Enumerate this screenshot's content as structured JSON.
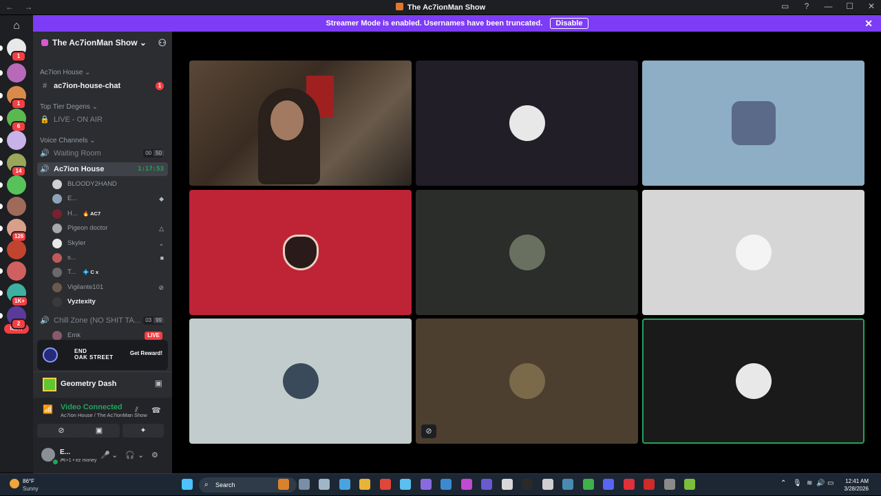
{
  "window": {
    "title": "The Ac7ionMan Show",
    "nav_back": "←",
    "nav_forward": "→",
    "controls": [
      "▭",
      "?",
      "—",
      "☐",
      "✕"
    ]
  },
  "banner": {
    "text": "Streamer Mode is enabled. Usernames have been truncated.",
    "disable_label": "Disable",
    "close": "✕"
  },
  "rail": {
    "discord_glyph": "⌂",
    "servers": [
      {
        "color": "#e8e8e8",
        "badge": "1"
      },
      {
        "color": "#b86ab8",
        "badge": ""
      },
      {
        "color": "#d98a4a",
        "badge": "1"
      },
      {
        "color": "#5bb84f",
        "badge": "6"
      },
      {
        "color": "#c7b3e8",
        "badge": ""
      },
      {
        "color": "#9aa65a",
        "badge": "14"
      },
      {
        "color": "#58c25a",
        "badge": ""
      },
      {
        "color": "#a06a5a",
        "badge": ""
      },
      {
        "color": "#d8a08a",
        "badge": "126"
      },
      {
        "color": "#c0442e",
        "badge": ""
      },
      {
        "color": "#d06060",
        "badge": ""
      },
      {
        "color": "#3fb0a0",
        "badge": "1K+"
      },
      {
        "color": "#5a3a9a",
        "badge": "2"
      }
    ],
    "new_label": "NEW"
  },
  "sidebar": {
    "server_name": "The Ac7ionMan Show",
    "chevron": "⌄",
    "add_user_glyph": "⚇",
    "categories": [
      {
        "label": "Ac7ion House ⌄"
      },
      {
        "label": "Top Tier Degens ⌄"
      },
      {
        "label": "Voice Channels ⌄"
      }
    ],
    "channels": {
      "chat": {
        "icon": "#",
        "name": "ac7ion-house-chat",
        "badge": "1"
      },
      "live": {
        "icon": "🔒",
        "name": "LIVE - ON AIR"
      },
      "waiting": {
        "icon": "🔊",
        "name": "Waiting Room",
        "count": "00",
        "limit": "50"
      },
      "house": {
        "icon": "🔊",
        "name": "Ac7ion House",
        "timer": "1:17:53"
      },
      "chill": {
        "icon": "🔊",
        "name": "Chill Zone (NO SHIT TA...",
        "count": "03",
        "limit": "99"
      }
    },
    "voice_users": [
      {
        "name": "BLOODY2HAND",
        "tag": "",
        "right": "",
        "color": "#d0d0d0",
        "bright": false
      },
      {
        "name": "E...",
        "tag": "",
        "right": "◆",
        "color": "#8fa3b8",
        "bright": false
      },
      {
        "name": "H...",
        "tag": "🔥 AC7",
        "right": "",
        "color": "#7a2030",
        "bright": false
      },
      {
        "name": "Pigeon doctor",
        "tag": "",
        "right": "△",
        "color": "#a8a8a8",
        "bright": false
      },
      {
        "name": "Skyler",
        "tag": "",
        "right": "⌄",
        "color": "#e8e8e8",
        "bright": false
      },
      {
        "name": "s...",
        "tag": "",
        "right": "■",
        "color": "#c05a5a",
        "bright": false
      },
      {
        "name": "T...",
        "tag": "💠 C x",
        "right": "",
        "color": "#6a6a6a",
        "bright": false
      },
      {
        "name": "Vigilante101",
        "tag": "",
        "right": "⊘",
        "color": "#6a5a4a",
        "bright": false
      },
      {
        "name": "Vyztexity",
        "tag": "",
        "right": "",
        "color": "#3a3a3a",
        "bright": true
      }
    ],
    "partial_user": "Emk",
    "live_label": "LIVE"
  },
  "promo": {
    "title_line1": "END",
    "title_line2": "OAK STREET",
    "reward_label": "Get Reward!"
  },
  "activity": {
    "game": "Geometry Dash",
    "icon": "▣"
  },
  "voice": {
    "status": "Video Connected",
    "location": "Ac7ion House / The Ac7ionMan Show",
    "signal_glyph": "📶",
    "noise_glyph": "⫽",
    "disconnect_glyph": "☎",
    "buttons": [
      "⊘",
      "▣",
      "✦"
    ]
  },
  "me": {
    "name": "E...",
    "status": "🎮+1 • ez money",
    "controls": [
      "🎤",
      "⌄",
      "🎧",
      "⌄",
      "⚙"
    ]
  },
  "tiles": [
    {
      "bg": "#4a3b30",
      "avatar": "#6a4a3a",
      "kind": "camera",
      "muted": false,
      "speaking": false
    },
    {
      "bg": "#221e27",
      "avatar": "#e8e8e8",
      "kind": "round",
      "muted": false,
      "speaking": false
    },
    {
      "bg": "#8daec4",
      "avatar": "#5a6a88",
      "kind": "big",
      "muted": false,
      "speaking": false
    },
    {
      "bg": "#bf2336",
      "avatar": "#bf2336",
      "kind": "spitfire",
      "muted": false,
      "speaking": false
    },
    {
      "bg": "#2a2d2a",
      "avatar": "#6a7060",
      "kind": "round",
      "muted": false,
      "speaking": false
    },
    {
      "bg": "#d6d6d6",
      "avatar": "#f4f4f4",
      "kind": "round",
      "muted": false,
      "speaking": false
    },
    {
      "bg": "#c2cccc",
      "avatar": "#3a4a5a",
      "kind": "round",
      "muted": false,
      "speaking": false
    },
    {
      "bg": "#4c3f30",
      "avatar": "#7a6a4a",
      "kind": "round",
      "muted": true,
      "speaking": false
    },
    {
      "bg": "#1a1a1a",
      "avatar": "#e8e8e8",
      "kind": "round",
      "muted": false,
      "speaking": true
    }
  ],
  "mute_glyph": "⊘",
  "taskbar": {
    "weather_temp": "86°F",
    "weather_desc": "Sunny",
    "search_placeholder": "Search",
    "search_glyph": "⌕",
    "start_color": "#4cc2ff",
    "apps": [
      "#d9822b",
      "#7a8ea8",
      "#9fb6c8",
      "#4aa3e0",
      "#e8b339",
      "#e0463a",
      "#5ac0f0",
      "#8a6ae0",
      "#3a8ad0",
      "#c04ad0",
      "#6a5ad0",
      "#d8d8d8",
      "#2a2a2a",
      "#cfcfcf",
      "#4a8ab0",
      "#3fb04a",
      "#5865f2",
      "#e0303a",
      "#d02a2a",
      "#8a8a8a",
      "#7ac03a"
    ],
    "tray_up": "⌃",
    "tray_mic": "🎙",
    "tray_wifi": "≋",
    "tray_vol": "🔊",
    "tray_bat": "▭",
    "time": "12:41 AM",
    "date": "3/28/2026"
  }
}
